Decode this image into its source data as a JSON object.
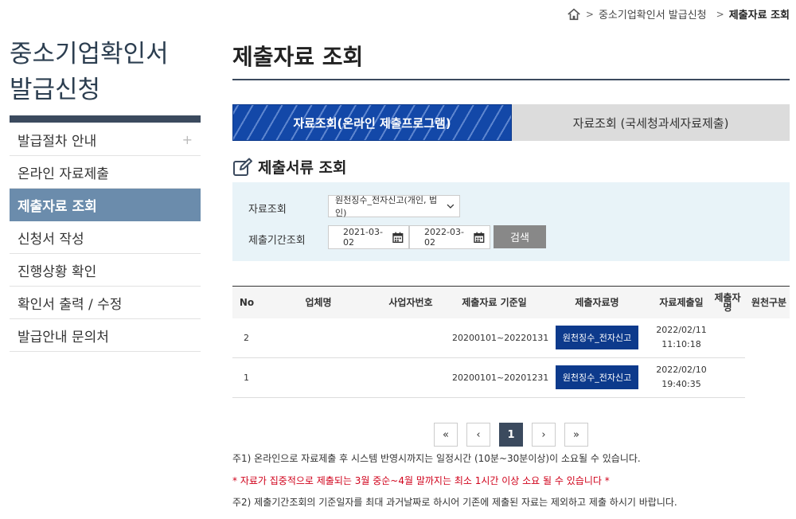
{
  "breadcrumb": {
    "home_icon": "home-icon",
    "item1": "중소기업확인서 발급신청",
    "item2": "제출자료 조회",
    "sep": ">"
  },
  "sidebar": {
    "title_line1": "중소기업확인서",
    "title_line2": "발급신청",
    "items": [
      {
        "label": "발급절차 안내",
        "suffix": "+"
      },
      {
        "label": "온라인 자료제출"
      },
      {
        "label": "제출자료 조회"
      },
      {
        "label": "신청서 작성"
      },
      {
        "label": "진행상황 확인"
      },
      {
        "label": "확인서 출력 / 수정"
      },
      {
        "label": "발급안내 문의처"
      }
    ]
  },
  "main": {
    "title": "제출자료 조회",
    "tabs": [
      {
        "label": "자료조회(온라인 제출프로그램)"
      },
      {
        "label": "자료조회 (국세청과세자료제출)"
      }
    ],
    "section_title": "제출서류 조회",
    "search": {
      "label_type": "자료조회",
      "select_value": "원천징수_전자신고(개인, 법인)",
      "label_period": "제출기간조회",
      "date_from": "2021-03-02",
      "date_to": "2022-03-02",
      "search_button": "검색"
    },
    "table": {
      "headers": [
        "No",
        "업체명",
        "사업자번호",
        "제출자료 기준일",
        "제출자료명",
        "자료제출일",
        "제출자명",
        "원천구분"
      ],
      "rows": [
        {
          "no": "2",
          "company": "",
          "bizno": "",
          "period": "20200101~20220131",
          "doc": "원천징수_전자신고",
          "date": "2022/02/11",
          "time": "11:10:18"
        },
        {
          "no": "1",
          "company": "",
          "bizno": "",
          "period": "20200101~20201231",
          "doc": "원천징수_전자신고",
          "date": "2022/02/10",
          "time": "19:40:35"
        }
      ]
    },
    "pager": {
      "first": "«",
      "prev": "‹",
      "current": "1",
      "next": "›",
      "last": "»"
    },
    "notes": [
      "주1) 온라인으로 자료제출 후 시스템 반영시까지는 일정시간 (10분~30분이상)이 소요될 수 있습니다.",
      "* 자료가 집중적으로 제출되는 3월 중순~4월 말까지는 최소 1시간 이상 소요 될 수 있습니다 *",
      "주2) 제출기간조회의 기준일자를 최대 과거날짜로 하시어 기존에 제출된 자료는 제외하고 제출 하시기 바랍니다."
    ]
  }
}
